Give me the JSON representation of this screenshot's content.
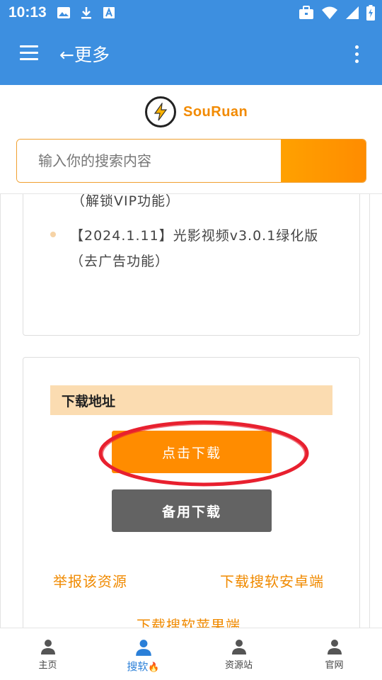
{
  "status_bar": {
    "time": "10:13",
    "icons": [
      "image-icon",
      "download-icon",
      "text-box-icon",
      "briefcase-icon",
      "wifi-icon",
      "signal-icon",
      "battery-icon"
    ]
  },
  "app_bar": {
    "title": "←更多",
    "menu_icon": "menu-icon",
    "more_icon": "more-vert-icon",
    "color": "#3d8fe0"
  },
  "brand": {
    "name": "SouRuan",
    "color": "#f28a00"
  },
  "search": {
    "placeholder": "输入你的搜索内容",
    "value": ""
  },
  "card1": {
    "partial_line": "（解锁VIP功能）",
    "item": "【2024.1.11】光影视频v3.0.1绿化版（去广告功能）"
  },
  "download": {
    "header": "下载地址",
    "primary_label": "点击下载",
    "secondary_label": "备用下载",
    "report_link": "举报该资源",
    "android_link": "下载搜软安卓端",
    "ios_link": "下载搜软苹果端",
    "accent": "#ff8c00"
  },
  "bottom_nav": {
    "items": [
      {
        "label": "主页",
        "icon": "person-icon"
      },
      {
        "label": "搜软",
        "icon": "person-icon",
        "badge": "🔥"
      },
      {
        "label": "资源站",
        "icon": "person-icon"
      },
      {
        "label": "官网",
        "icon": "person-icon"
      }
    ],
    "active_index": 1
  }
}
